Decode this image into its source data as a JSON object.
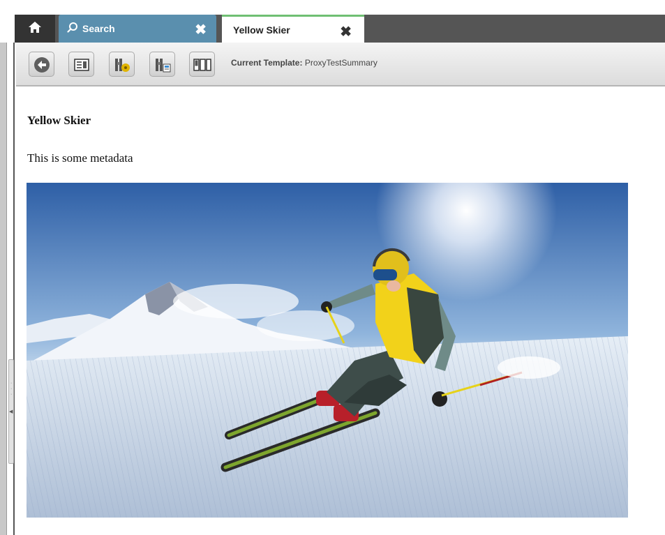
{
  "tabs": {
    "home_icon": "home-icon",
    "search_label": "Search",
    "search_icon": "search-icon",
    "active_label": "Yellow Skier",
    "close_glyph": "✖"
  },
  "toolbar": {
    "buttons": [
      "back-icon",
      "list-view-icon",
      "binoculars-icon",
      "binoculars-page-icon",
      "layout-icon"
    ],
    "template_key": "Current Template:",
    "template_value": "ProxyTestSummary"
  },
  "content": {
    "title": "Yellow Skier",
    "metadata": "This is some metadata",
    "image_subject": "skier in yellow jacket on groomed slope"
  },
  "colors": {
    "search_tab": "#5a8fae",
    "active_tab_accent": "#6fbf73",
    "tabbar": "#555555"
  }
}
